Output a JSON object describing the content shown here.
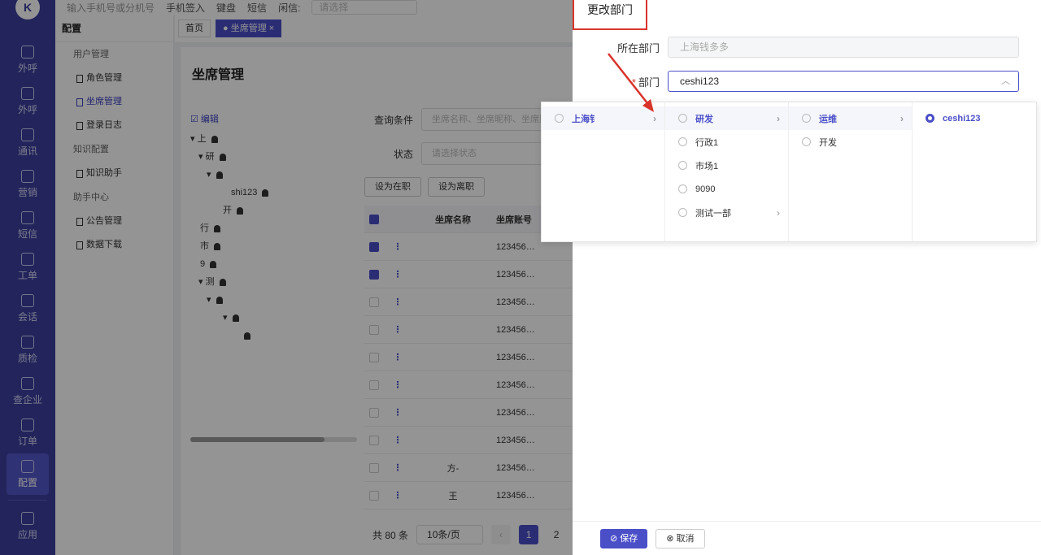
{
  "topbar": {
    "phone_placeholder": "输入手机号或分机号",
    "mobile_signin": "手机签入",
    "keyboard": "键盘",
    "sms": "短信",
    "busy_label": "闲信:",
    "busy_placeholder": "请选择"
  },
  "rail": {
    "logo": "K",
    "items": [
      {
        "label": "外呼",
        "icon": "phone-out-icon"
      },
      {
        "label": "外呼",
        "icon": "phone-out-icon"
      },
      {
        "label": "通讯",
        "icon": "contacts-icon"
      },
      {
        "label": "营销",
        "icon": "marketing-icon"
      },
      {
        "label": "短信",
        "icon": "sms-icon"
      },
      {
        "label": "工单",
        "icon": "ticket-icon"
      },
      {
        "label": "会话",
        "icon": "chat-icon"
      },
      {
        "label": "质检",
        "icon": "quality-icon"
      },
      {
        "label": "查企业",
        "icon": "company-icon"
      },
      {
        "label": "订单",
        "icon": "order-icon"
      },
      {
        "label": "配置",
        "icon": "config-icon"
      },
      {
        "label": "应用",
        "icon": "app-icon"
      }
    ]
  },
  "subnav": {
    "head": "配置",
    "group_users": "用户管理",
    "role": "角色管理",
    "seat": "坐席管理",
    "login_log": "登录日志",
    "group_knowledge": "知识配置",
    "assistant": "知识助手",
    "group_help": "助手中心",
    "notice": "公告管理",
    "download": "数据下载"
  },
  "tabs": {
    "home": "首页",
    "seat": "● 坐席管理 ×"
  },
  "main": {
    "title": "坐席管理",
    "edit": "☑ 编辑",
    "tree": [
      "▾ 上",
      "▾ 研",
      "▾",
      "shi123",
      "开",
      "行",
      "市",
      "9",
      "▾ 测",
      "▾",
      "▾",
      ""
    ],
    "filter_label": "查询条件",
    "filter_placeholder": "坐席名称、坐席昵称、坐席账号",
    "status_label": "状态",
    "status_placeholder": "请选择状态",
    "btn_on": "设为在职",
    "btn_off": "设为离职",
    "col_name": "坐席名称",
    "col_account": "坐席账号",
    "rows": [
      {
        "name": "",
        "account": "123456…",
        "checked": true
      },
      {
        "name": "",
        "account": "123456…",
        "checked": true
      },
      {
        "name": "",
        "account": "123456…",
        "checked": false
      },
      {
        "name": "",
        "account": "123456…",
        "checked": false
      },
      {
        "name": "",
        "account": "123456…",
        "checked": false
      },
      {
        "name": "",
        "account": "123456…",
        "checked": false
      },
      {
        "name": "",
        "account": "123456…",
        "checked": false
      },
      {
        "name": "",
        "account": "123456…",
        "checked": false
      },
      {
        "name": "方-",
        "account": "123456…",
        "checked": false
      },
      {
        "name": "王",
        "account": "123456…",
        "checked": false
      }
    ],
    "total": "共 80 条",
    "page_size": "10条/页",
    "page1": "1",
    "page2": "2"
  },
  "drawer": {
    "title": "更改部门",
    "current_dept_label": "所在部门",
    "current_dept_value": "上海钱多多",
    "dept_label": "部门",
    "dept_value": "ceshi123",
    "save": "⊘ 保存",
    "cancel": "⊗ 取消"
  },
  "cascader": {
    "col1": [
      {
        "label": "上海钅",
        "sel": true,
        "arrow": true
      }
    ],
    "col2": [
      {
        "label": "研发",
        "sel": true,
        "arrow": true
      },
      {
        "label": "行政1",
        "sel": false,
        "arrow": false
      },
      {
        "label": "市场1",
        "sel": false,
        "arrow": false
      },
      {
        "label": "9090",
        "sel": false,
        "arrow": false
      },
      {
        "label": "测试一部",
        "sel": false,
        "arrow": true
      }
    ],
    "col3": [
      {
        "label": "运维",
        "sel": true,
        "arrow": true
      },
      {
        "label": "开发",
        "sel": false,
        "arrow": false
      }
    ],
    "col4": [
      {
        "label": "ceshi123",
        "sel": true,
        "arrow": false,
        "checked": true
      }
    ]
  },
  "colors": {
    "brand": "#3b3f9e",
    "accent": "#4a4fc8",
    "annotation": "#d9342b"
  }
}
